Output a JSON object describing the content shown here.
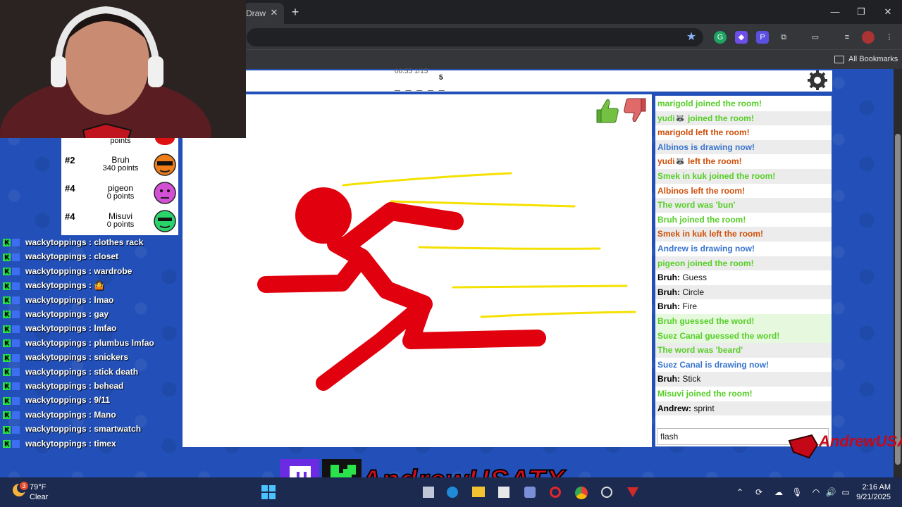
{
  "browser": {
    "tab_title": "Draw",
    "tab_close": "✕",
    "new_tab": "+",
    "bookmarks_label": "All Bookmarks",
    "window_controls": {
      "minimize": "—",
      "maximize": "❐",
      "close": "✕"
    }
  },
  "game": {
    "round_info": "00:55  1/15",
    "word_hint": "_ _ _ _ _",
    "word_length": "5",
    "players": [
      {
        "rank": "",
        "name": "",
        "points": "points"
      },
      {
        "rank": "#2",
        "name": "Bruh",
        "points": "340 points"
      },
      {
        "rank": "#4",
        "name": "pigeon",
        "points": "0 points"
      },
      {
        "rank": "#4",
        "name": "Misuvi",
        "points": "0 points"
      }
    ],
    "chat": [
      {
        "user": "",
        "text": "marigold joined the room!",
        "color": "g"
      },
      {
        "user": "",
        "text": "yudi🦝 joined the room!",
        "color": "g"
      },
      {
        "user": "",
        "text": "marigold left the room!",
        "color": "r"
      },
      {
        "user": "",
        "text": "Albinos is drawing now!",
        "color": "b"
      },
      {
        "user": "",
        "text": "yudi🦝 left the room!",
        "color": "r"
      },
      {
        "user": "",
        "text": "Smek in kuk joined the room!",
        "color": "g"
      },
      {
        "user": "",
        "text": "Albinos left the room!",
        "color": "r"
      },
      {
        "user": "",
        "text": "The word was 'bun'",
        "color": "g"
      },
      {
        "user": "",
        "text": "Bruh joined the room!",
        "color": "g"
      },
      {
        "user": "",
        "text": "Smek in kuk left the room!",
        "color": "r"
      },
      {
        "user": "",
        "text": "Andrew is drawing now!",
        "color": "b"
      },
      {
        "user": "",
        "text": "pigeon joined the room!",
        "color": "g"
      },
      {
        "user": "Bruh:",
        "text": "Guess",
        "color": "k"
      },
      {
        "user": "Bruh:",
        "text": "Circle",
        "color": "k"
      },
      {
        "user": "Bruh:",
        "text": "Fire",
        "color": "k"
      },
      {
        "user": "",
        "text": "Bruh guessed the word!",
        "color": "g"
      },
      {
        "user": "",
        "text": "Suez Canal guessed the word!",
        "color": "g"
      },
      {
        "user": "",
        "text": "The word was 'beard'",
        "color": "g"
      },
      {
        "user": "",
        "text": "Suez Canal is drawing now!",
        "color": "b"
      },
      {
        "user": "Bruh:",
        "text": "Stick",
        "color": "k"
      },
      {
        "user": "",
        "text": "Misuvi joined the room!",
        "color": "g"
      },
      {
        "user": "Andrew:",
        "text": "sprint",
        "color": "k"
      }
    ],
    "chat_input_value": "flash",
    "drawing_colors": {
      "figure": "#e0000e",
      "speed_lines": "#f5e100"
    }
  },
  "stream": {
    "twitch_chat": [
      {
        "user": "wackytoppings",
        "msg": "clothes rack"
      },
      {
        "user": "wackytoppings",
        "msg": "closet"
      },
      {
        "user": "wackytoppings",
        "msg": "wardrobe"
      },
      {
        "user": "wackytoppings",
        "msg": "🤷"
      },
      {
        "user": "wackytoppings",
        "msg": "lmao"
      },
      {
        "user": "wackytoppings",
        "msg": "gay"
      },
      {
        "user": "wackytoppings",
        "msg": "lmfao"
      },
      {
        "user": "wackytoppings",
        "msg": "plumbus lmfao"
      },
      {
        "user": "wackytoppings",
        "msg": "snickers"
      },
      {
        "user": "wackytoppings",
        "msg": "stick death"
      },
      {
        "user": "wackytoppings",
        "msg": "behead"
      },
      {
        "user": "wackytoppings",
        "msg": "9/11"
      },
      {
        "user": "wackytoppings",
        "msg": "Mano"
      },
      {
        "user": "wackytoppings",
        "msg": "smartwatch"
      },
      {
        "user": "wackytoppings",
        "msg": "timex"
      }
    ],
    "brand_text": "AndrewUSATX",
    "corner_text": "AndrewUSATX"
  },
  "taskbar": {
    "temp": "79°F",
    "weather": "Clear",
    "weather_badge": "3",
    "time": "2:16 AM",
    "date": "9/21/2025"
  }
}
